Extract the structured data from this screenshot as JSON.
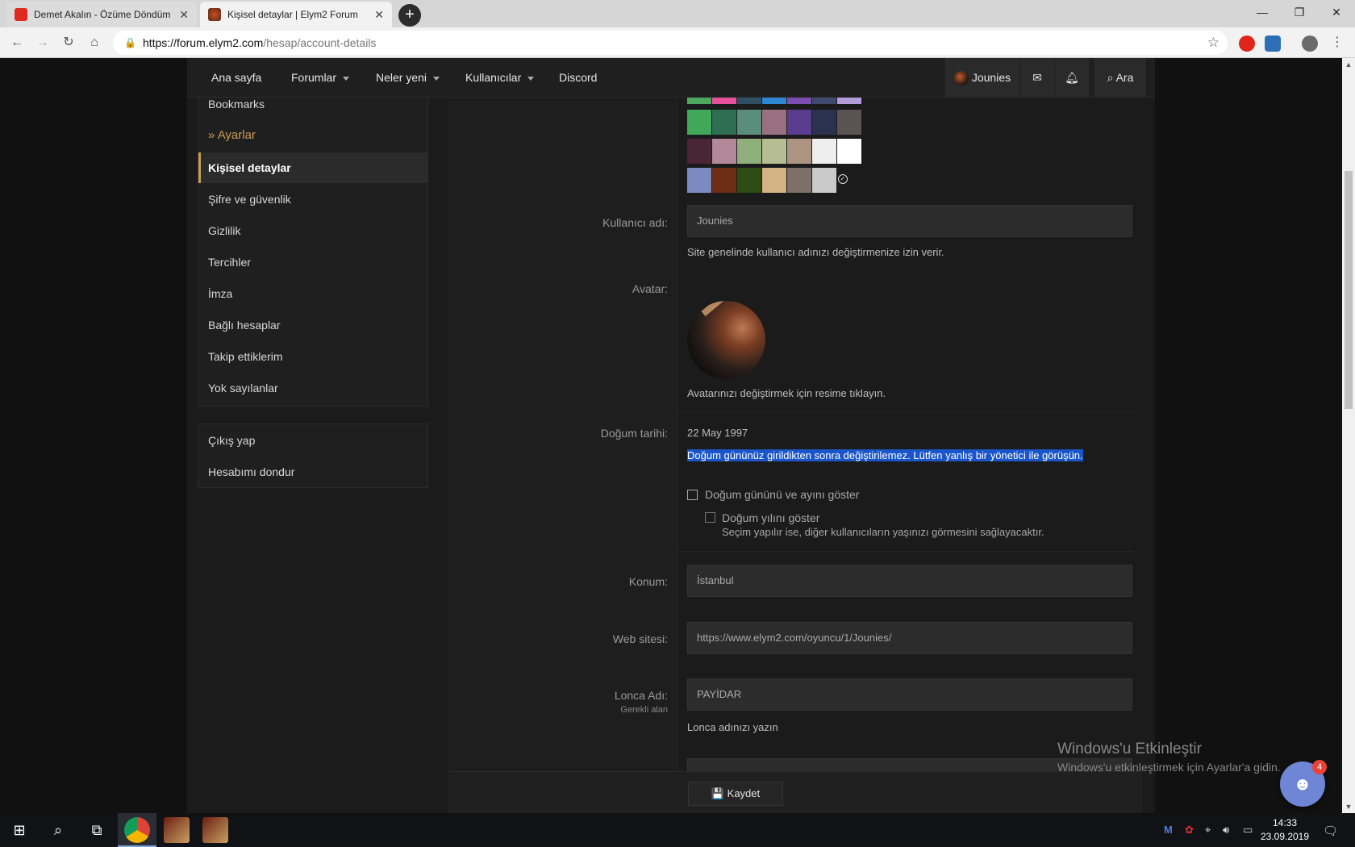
{
  "browser": {
    "tabs": [
      {
        "title": "Demet Akalın - Özüme Döndüm",
        "active": false
      },
      {
        "title": "Kişisel detaylar | Elym2 Forum",
        "active": true
      }
    ],
    "new_tab": "+",
    "url_host": "https://forum.elym2.com",
    "url_path": "/hesap/account-details",
    "controls": {
      "minimize": "—",
      "maximize": "❐",
      "close": "✕"
    }
  },
  "navbar": {
    "items": [
      {
        "label": "Ana sayfa",
        "dropdown": false
      },
      {
        "label": "Forumlar",
        "dropdown": true
      },
      {
        "label": "Neler yeni",
        "dropdown": true
      },
      {
        "label": "Kullanıcılar",
        "dropdown": true
      },
      {
        "label": "Discord",
        "dropdown": false
      }
    ],
    "user": "Jounies",
    "search": "Ara"
  },
  "sidebar": {
    "bookmarks": "Bookmarks",
    "section": "Ayarlar",
    "items": [
      {
        "label": "Kişisel detaylar",
        "active": true
      },
      {
        "label": "Şifre ve güvenlik",
        "active": false
      },
      {
        "label": "Gizlilik",
        "active": false
      },
      {
        "label": "Tercihler",
        "active": false
      },
      {
        "label": "İmza",
        "active": false
      },
      {
        "label": "Bağlı hesaplar",
        "active": false
      },
      {
        "label": "Takip ettiklerim",
        "active": false
      },
      {
        "label": "Yok sayılanlar",
        "active": false
      }
    ],
    "account": [
      {
        "label": "Çıkış yap"
      },
      {
        "label": "Hesabımı dondur"
      }
    ]
  },
  "colors": {
    "accent": "#c99c52",
    "selection": "#1a56c9",
    "discord": "#6f86d6",
    "swatches": [
      [
        "#4ca95e",
        "#e8509a",
        "#2e4e63",
        "#2f86d3",
        "#7c4db0",
        "#3f4a6e",
        "#b39ddb"
      ],
      [
        "#3fa85a",
        "#2e6e52",
        "#5a8d7c",
        "#9a7182",
        "#5b3d8f",
        "#2b3250",
        "#5b5252"
      ],
      [
        "#4a2536",
        "#b3899a",
        "#8fb07a",
        "#b7bd93",
        "#ad9382",
        "#ededed",
        "#ffffff"
      ],
      [
        "#7b8ac0",
        "#6e2e16",
        "#2e4d14",
        "#d3b383",
        "#7d7068",
        "#c9c9c9"
      ]
    ]
  },
  "form": {
    "username": {
      "label": "Kullanıcı adı:",
      "value": "Jounies",
      "hint": "Site genelinde kullanıcı adınızı değiştirmenize izin verir."
    },
    "avatar": {
      "label": "Avatar:",
      "hint": "Avatarınızı değiştirmek için resime tıklayın."
    },
    "dob": {
      "label": "Doğum tarihi:",
      "value": "22 May 1997",
      "note": "Doğum gününüz girildikten sonra değiştirilemez. Lütfen yanlış bir yönetici ile görüşün.",
      "show_day_month": "Doğum gününü ve ayını göster",
      "show_year": "Doğum yılını göster",
      "show_year_hint": "Seçim yapılır ise, diğer kullanıcıların yaşınızı görmesini sağlayacaktır."
    },
    "location": {
      "label": "Konum:",
      "value": "İstanbul"
    },
    "website": {
      "label": "Web sitesi:",
      "value": "https://www.elym2.com/oyuncu/1/Jounies/"
    },
    "guild": {
      "label": "Lonca Adı:",
      "required": "Gerekli alan",
      "value": "PAYİDAR",
      "hint": "Lonca adınızı yazın"
    },
    "save": "Kaydet"
  },
  "watermark": {
    "title": "Windows'u Etkinleştir",
    "subtitle": "Windows'u etkinleştirmek için Ayarlar'a gidin."
  },
  "discord_badge": "4",
  "taskbar": {
    "time": "14:33",
    "date": "23.09.2019"
  }
}
